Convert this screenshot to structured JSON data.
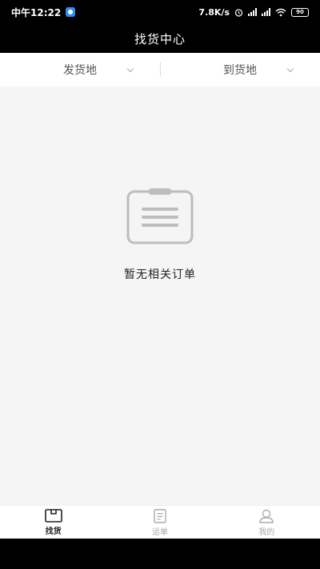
{
  "status_bar": {
    "time": "中午12:22",
    "net_speed": "7.8K/s",
    "battery": "90"
  },
  "header": {
    "title": "找货中心"
  },
  "filters": [
    {
      "label": "发货地"
    },
    {
      "label": "到货地"
    }
  ],
  "empty_state": {
    "icon": "clipboard-icon",
    "message": "暂无相关订单"
  },
  "tabs": [
    {
      "label": "找货",
      "icon": "box-icon",
      "active": true
    },
    {
      "label": "运单",
      "icon": "document-icon",
      "active": false
    },
    {
      "label": "我的",
      "icon": "user-icon",
      "active": false
    }
  ],
  "colors": {
    "header_bg": "#000000",
    "content_bg": "#f5f5f5",
    "icon_gray": "#bdbdbd"
  }
}
